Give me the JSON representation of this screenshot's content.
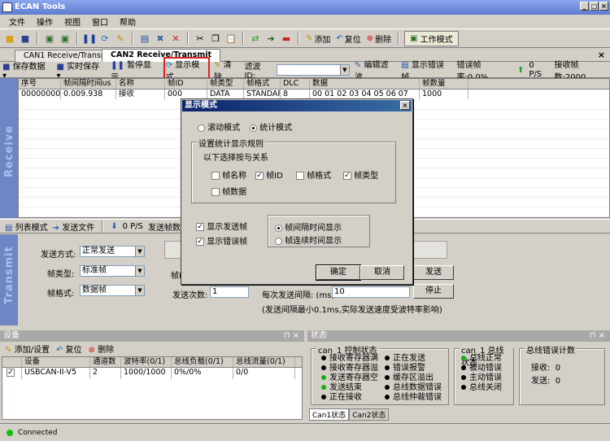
{
  "window": {
    "title": "ECAN Tools"
  },
  "menu": [
    "文件",
    "操作",
    "视图",
    "窗口",
    "帮助"
  ],
  "toolbar": {
    "add": "添加",
    "reset": "复位",
    "delete": "删除",
    "work_mode": "工作模式"
  },
  "tabs": [
    {
      "label": "CAN1 Receive/Transmit"
    },
    {
      "label": "CAN2 Receive/Transmit"
    }
  ],
  "rx_toolbar": {
    "save_data": "保存数据",
    "realtime_save": "实时保存",
    "pause": "暂停显示",
    "display_mode": "显示模式",
    "clear": "清除",
    "filter_id": "滤波ID:",
    "edit_filter": "编辑滤波",
    "show_error_frame": "显示错误帧",
    "error_rate": "错误帧率:0.0%",
    "fps": "0 P/S",
    "rx_count": "接收帧数:2000"
  },
  "side_labels": {
    "receive": "Receive",
    "transmit": "Transmit"
  },
  "grid": {
    "columns": [
      "序号",
      "帧间隔时间us",
      "名称",
      "帧ID",
      "帧类型",
      "帧格式",
      "DLC",
      "数据",
      "帧数量"
    ],
    "rows": [
      [
        "00000000",
        "0.009.938",
        "接收",
        "000",
        "DATA",
        "STANDARD",
        "8",
        "00 01 02 03 04 05 06 07",
        "1000"
      ]
    ]
  },
  "list_toolbar": {
    "list_mode": "列表模式",
    "send_file": "发送文件",
    "fps": "0 P/S",
    "tx_count": "发送帧数"
  },
  "transmit": {
    "send_mode_label": "发送方式:",
    "send_mode_value": "正常发送",
    "frame_type_label": "帧类型:",
    "frame_type_value": "标准帧",
    "frame_format_label": "帧格式:",
    "frame_format_value": "数据帧",
    "frame_id_label": "帧I",
    "send_count_label": "发送次数:",
    "send_count_value": "1",
    "interval_label": "每次发送间隔: (ms)",
    "interval_value": "10",
    "send_button": "发送",
    "stop_button": "停止",
    "note": "(发送间隔最小0.1ms,实际发送速度受波特率影响)"
  },
  "dialog": {
    "title": "显示模式",
    "scroll_mode": "滚动模式",
    "stat_mode": "统计模式",
    "group_title": "设置统计显示规则",
    "group_hint": "以下选择按与关系",
    "checks": [
      {
        "label": "帧名称",
        "checked": false
      },
      {
        "label": "帧ID",
        "checked": true
      },
      {
        "label": "帧格式",
        "checked": false
      },
      {
        "label": "帧类型",
        "checked": true
      },
      {
        "label": "帧数据",
        "checked": false
      }
    ],
    "show_tx_frame": "显示发送帧",
    "show_err_frame": "显示错误帧",
    "interval_display": "帧间隔时间显示",
    "continuous_display": "帧连续时间显示",
    "ok": "确定",
    "cancel": "取消"
  },
  "device_panel": {
    "title": "设备",
    "add_set": "添加/设置",
    "reset": "复位",
    "delete": "删除",
    "columns": [
      "设备",
      "通道数",
      "波特率(0/1)",
      "总线负载(0/1)",
      "总线流量(0/1)"
    ],
    "row": [
      "USBCAN-II-V5",
      "2",
      "1000/1000",
      "0%/0%",
      "0/0"
    ]
  },
  "status_panel": {
    "title": "状态",
    "control_title": "can_1 控制状态",
    "control_items": [
      {
        "label": "接收寄存器满",
        "color": "#000000"
      },
      {
        "label": "接收寄存器溢",
        "color": "#000000"
      },
      {
        "label": "发送寄存器空",
        "color": "#10b010"
      },
      {
        "label": "发送结束",
        "color": "#10b010"
      },
      {
        "label": "正在接收",
        "color": "#000000"
      }
    ],
    "control_items2": [
      {
        "label": "正在发送",
        "color": "#000000"
      },
      {
        "label": "错误报警",
        "color": "#000000"
      },
      {
        "label": "缓存区溢出",
        "color": "#000000"
      },
      {
        "label": "总线数据错误",
        "color": "#000000"
      },
      {
        "label": "总线仲裁错误",
        "color": "#000000"
      }
    ],
    "bus_title": "can_1 总线状态",
    "bus_items": [
      {
        "label": "总线正常",
        "color": "#10b010"
      },
      {
        "label": "被动错误",
        "color": "#000000"
      },
      {
        "label": "主动错误",
        "color": "#000000"
      },
      {
        "label": "总线关闭",
        "color": "#000000"
      }
    ],
    "err_title": "总线错误计数",
    "rx_label": "接收:",
    "rx_value": "0",
    "tx_label": "发送:",
    "tx_value": "0",
    "tabs": [
      "Can1状态",
      "Can2状态"
    ]
  },
  "statusbar": {
    "text": "Connected",
    "color": "#10c010"
  }
}
